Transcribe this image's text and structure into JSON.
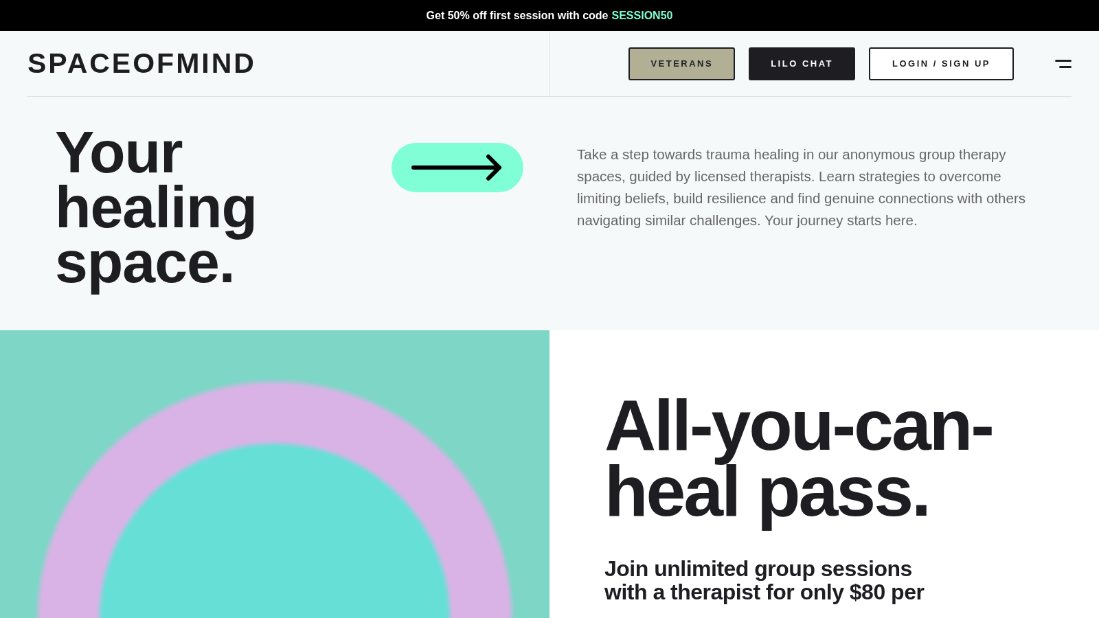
{
  "promo_bar": {
    "text": "Get 50% off first session with code",
    "code": "SESSION50"
  },
  "header": {
    "logo": "SPACEOFMIND",
    "buttons": [
      {
        "label": "VETERANS",
        "kind": "tan"
      },
      {
        "label": "LILO CHAT",
        "kind": "dark"
      },
      {
        "label": "LOGIN / SIGN UP",
        "kind": "outline"
      }
    ]
  },
  "hero": {
    "title_lines": [
      "Your",
      "healing",
      "space."
    ],
    "description": "Take a step towards trauma healing in our anonymous group therapy spaces, guided by licensed therapists. Learn strategies to overcome limiting beliefs, build resilience and find genuine connections with others navigating similar challenges. Your journey starts here."
  },
  "pass": {
    "title_lines": [
      "All-you-can-",
      "heal pass."
    ],
    "subtitle_lines": [
      "Join unlimited group sessions",
      "with a therapist for only $80 per"
    ]
  }
}
